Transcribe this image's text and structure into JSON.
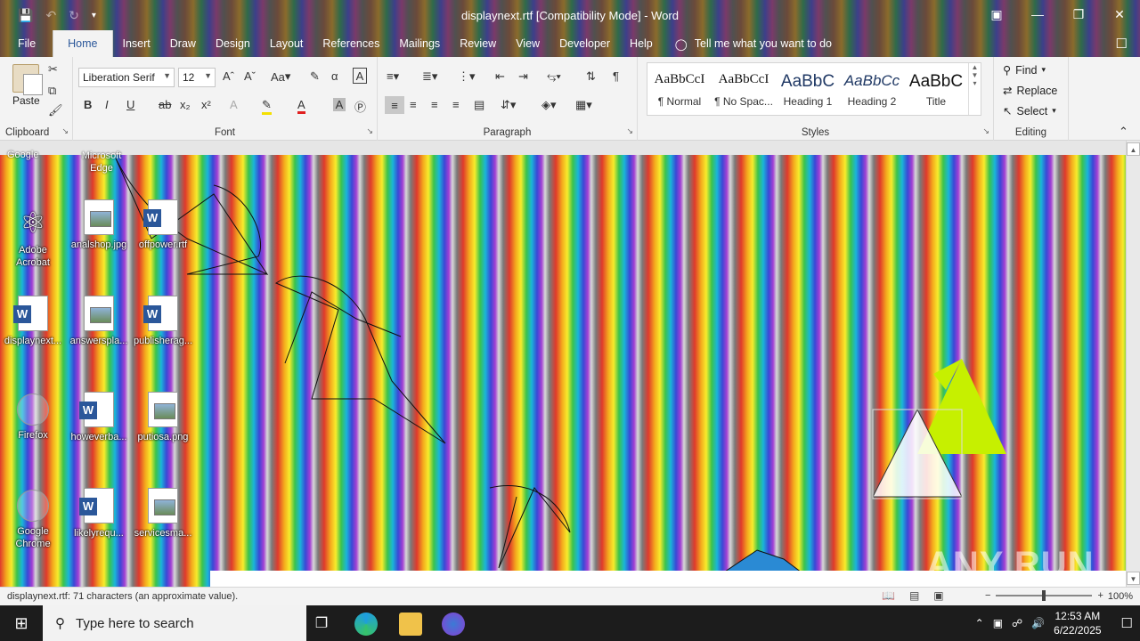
{
  "window": {
    "title": "displaynext.rtf [Compatibility Mode]  -  Word"
  },
  "tabs": [
    {
      "label": "File"
    },
    {
      "label": "Home"
    },
    {
      "label": "Insert"
    },
    {
      "label": "Draw"
    },
    {
      "label": "Design"
    },
    {
      "label": "Layout"
    },
    {
      "label": "References"
    },
    {
      "label": "Mailings"
    },
    {
      "label": "Review"
    },
    {
      "label": "View"
    },
    {
      "label": "Developer"
    },
    {
      "label": "Help"
    }
  ],
  "tell_me": "Tell me what you want to do",
  "clipboard": {
    "paste": "Paste",
    "label": "Clipboard"
  },
  "font": {
    "name": "Liberation Serif",
    "size": "12",
    "label": "Font",
    "case_btn": "Aa"
  },
  "paragraph": {
    "label": "Paragraph"
  },
  "styles": {
    "label": "Styles",
    "items": [
      {
        "sample": "AaBbCcI",
        "name": "¶ Normal"
      },
      {
        "sample": "AaBbCcI",
        "name": "¶ No Spac..."
      },
      {
        "sample": "AaBbC",
        "name": "Heading 1"
      },
      {
        "sample": "AaBbCc",
        "name": "Heading 2"
      },
      {
        "sample": "AaBbC",
        "name": "Title"
      }
    ]
  },
  "editing": {
    "label": "Editing",
    "find": "Find",
    "replace": "Replace",
    "select": "Select"
  },
  "desktop_icons": [
    {
      "label": "Adobe Acrobat",
      "kind": "pdf"
    },
    {
      "label": "analshop.jpg",
      "kind": "img"
    },
    {
      "label": "offpower.rtf",
      "kind": "word"
    },
    {
      "label": "displaynext...",
      "kind": "word"
    },
    {
      "label": "answerspla...",
      "kind": "img"
    },
    {
      "label": "publisherag...",
      "kind": "word"
    },
    {
      "label": "Firefox",
      "kind": "app"
    },
    {
      "label": "howeverba...",
      "kind": "word"
    },
    {
      "label": "putiosa.png",
      "kind": "img"
    },
    {
      "label": "Google Chrome",
      "kind": "app"
    },
    {
      "label": "likelyrequ...",
      "kind": "word"
    },
    {
      "label": "servicesma...",
      "kind": "img"
    }
  ],
  "partial_top_labels": [
    "Google",
    "Microsoft Edge"
  ],
  "status": {
    "message": "displaynext.rtf: 71 characters (an approximate value).",
    "zoom": "100%",
    "zoom_level": 100
  },
  "taskbar": {
    "search_placeholder": "Type here to search",
    "time": "12:53 AM",
    "date": "6/22/2025"
  },
  "watermark": "ANY RUN",
  "colors": {
    "word_blue": "#2b579a",
    "ribbon_bg": "#f3f3f3",
    "taskbar_bg": "#1c1c1c"
  }
}
